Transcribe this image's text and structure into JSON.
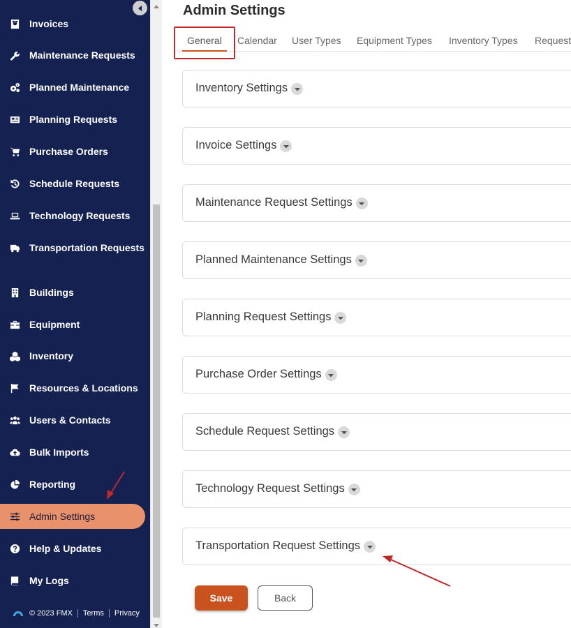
{
  "sidebar": {
    "items": [
      {
        "label": "Invoices",
        "icon": "invoice-icon"
      },
      {
        "label": "Maintenance Requests",
        "icon": "wrench-icon"
      },
      {
        "label": "Planned Maintenance",
        "icon": "gears-icon"
      },
      {
        "label": "Planning Requests",
        "icon": "newspaper-icon"
      },
      {
        "label": "Purchase Orders",
        "icon": "cart-icon"
      },
      {
        "label": "Schedule Requests",
        "icon": "history-icon"
      },
      {
        "label": "Technology Requests",
        "icon": "laptop-icon"
      },
      {
        "label": "Transportation Requests",
        "icon": "truck-icon"
      },
      {
        "label": "Buildings",
        "icon": "building-icon"
      },
      {
        "label": "Equipment",
        "icon": "toolbox-icon"
      },
      {
        "label": "Inventory",
        "icon": "boxes-icon"
      },
      {
        "label": "Resources & Locations",
        "icon": "flag-icon"
      },
      {
        "label": "Users & Contacts",
        "icon": "users-icon"
      },
      {
        "label": "Bulk Imports",
        "icon": "cloud-upload-icon"
      },
      {
        "label": "Reporting",
        "icon": "pie-chart-icon"
      },
      {
        "label": "Admin Settings",
        "icon": "sliders-icon",
        "active": true
      },
      {
        "label": "Help & Updates",
        "icon": "question-circle-icon"
      },
      {
        "label": "My Logs",
        "icon": "book-icon"
      }
    ],
    "footer": {
      "copyright": "© 2023 FMX",
      "terms": "Terms",
      "privacy": "Privacy"
    }
  },
  "main": {
    "title": "Admin Settings",
    "tabs": [
      {
        "label": "General",
        "active": true
      },
      {
        "label": "Calendar"
      },
      {
        "label": "User Types"
      },
      {
        "label": "Equipment Types"
      },
      {
        "label": "Inventory Types"
      },
      {
        "label": "Request"
      }
    ],
    "panels": [
      {
        "label": "Inventory Settings"
      },
      {
        "label": "Invoice Settings"
      },
      {
        "label": "Maintenance Request Settings"
      },
      {
        "label": "Planned Maintenance Settings"
      },
      {
        "label": "Planning Request Settings"
      },
      {
        "label": "Purchase Order Settings"
      },
      {
        "label": "Schedule Request Settings"
      },
      {
        "label": "Technology Request Settings"
      },
      {
        "label": "Transportation Request Settings"
      }
    ],
    "save_label": "Save",
    "back_label": "Back"
  },
  "colors": {
    "sidebar_bg": "#142151",
    "active_item_bg": "#e8916b",
    "accent": "#c9521f",
    "annotation_red": "#c0282b"
  }
}
